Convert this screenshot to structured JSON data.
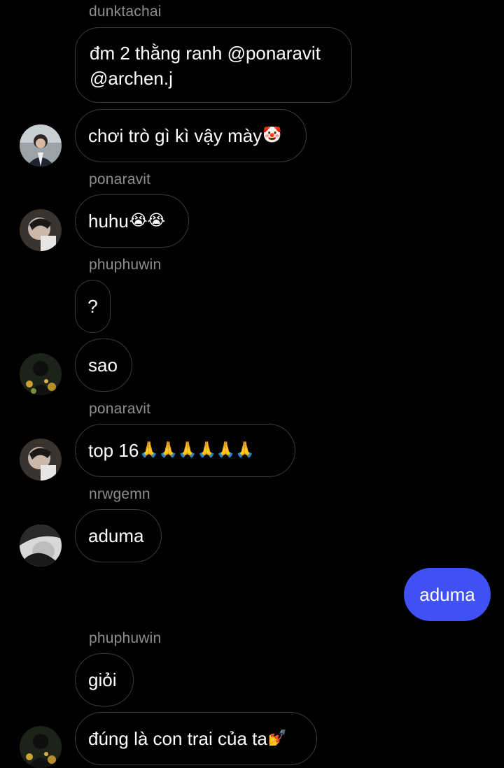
{
  "messages": [
    {
      "sender": "dunktachai",
      "line1": "đm 2 thằng ranh @ponaravit",
      "line2": "@archen.j"
    },
    {
      "text": "chơi trò gì kì vậy mày",
      "emoji": "🤡",
      "avatar_icon": "profile-photo-dunktachai"
    },
    {
      "sender": "ponaravit",
      "text": "huhu",
      "emoji": "😭😭",
      "avatar_icon": "profile-photo-ponaravit"
    },
    {
      "sender": "phuphuwin",
      "text": "?"
    },
    {
      "text": "sao",
      "avatar_icon": "profile-photo-phuphuwin"
    },
    {
      "sender": "ponaravit",
      "text": "top 16",
      "emoji": "🙏🙏🙏🙏🙏🙏",
      "avatar_icon": "profile-photo-ponaravit"
    },
    {
      "sender": "nrwgemn",
      "text": "aduma",
      "avatar_icon": "profile-photo-nrwgemn"
    },
    {
      "outgoing": true,
      "text": "aduma",
      "color": "#3f51f5"
    },
    {
      "sender": "phuphuwin",
      "text": "giỏi"
    },
    {
      "text": "đúng là con trai của ta",
      "emoji": "💅",
      "avatar_icon": "profile-photo-phuphuwin"
    }
  ],
  "colors": {
    "background": "#000000",
    "bubble_border": "#3a3a3a",
    "sender_text": "#8e8e8e",
    "outgoing_bubble": "#3f51f5"
  }
}
